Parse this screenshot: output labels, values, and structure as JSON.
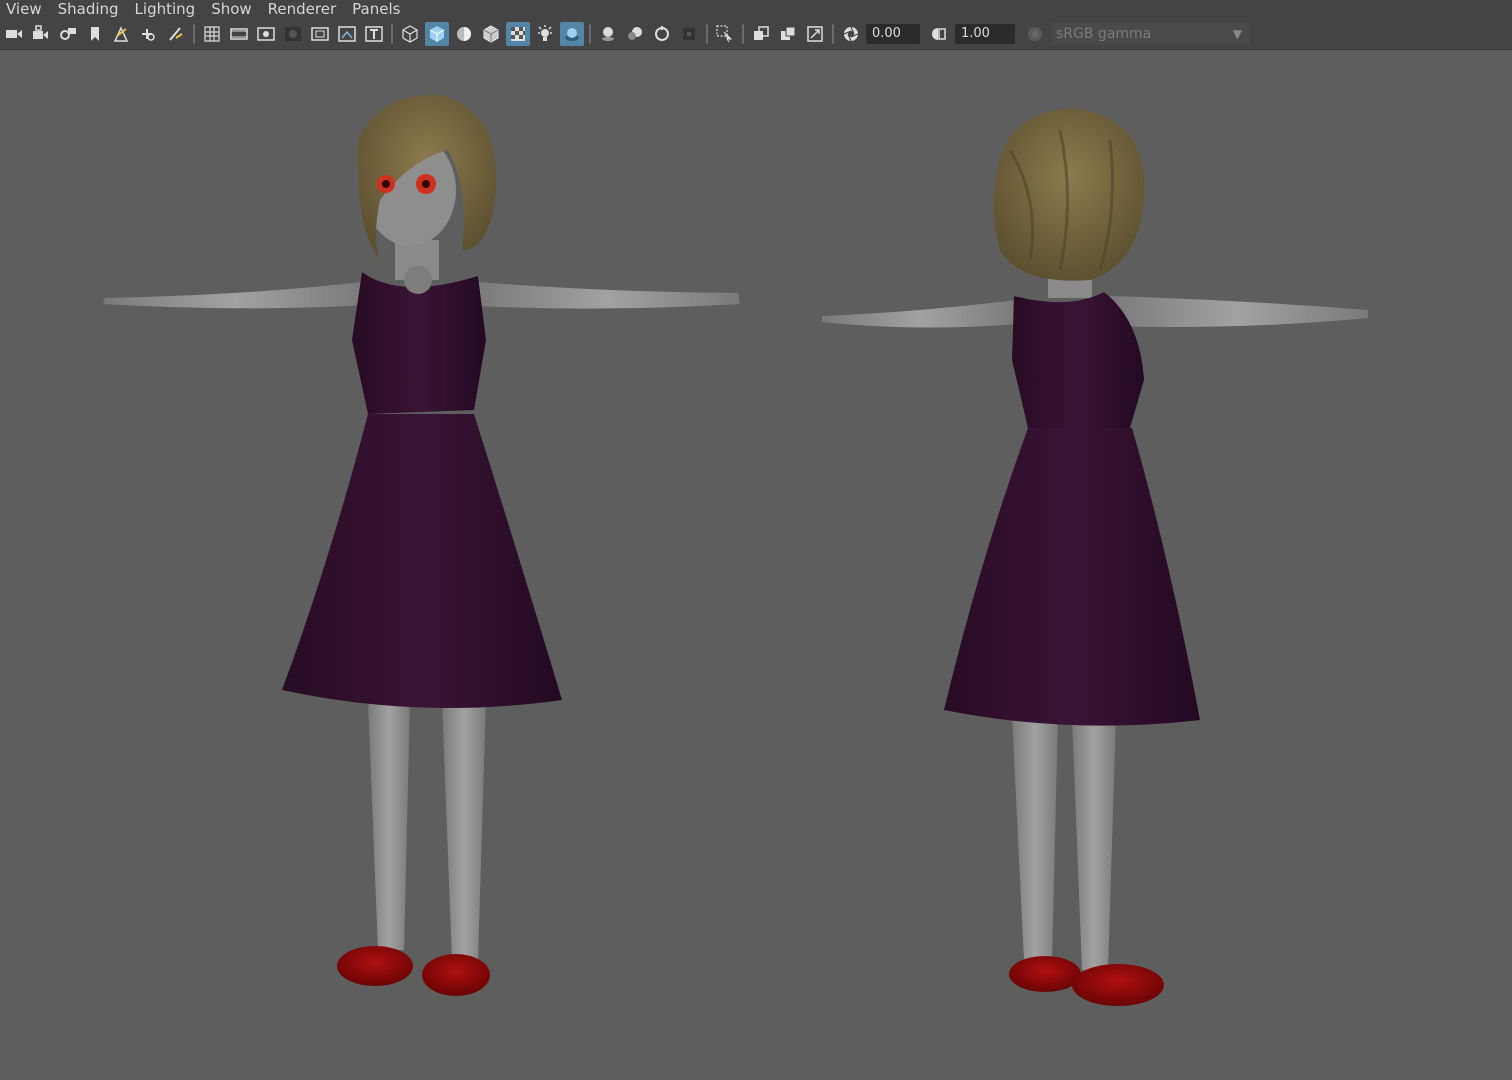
{
  "menubar": {
    "items": [
      {
        "label": "View"
      },
      {
        "label": "Shading"
      },
      {
        "label": "Lighting"
      },
      {
        "label": "Show"
      },
      {
        "label": "Renderer"
      },
      {
        "label": "Panels"
      }
    ]
  },
  "toolbar": {
    "exposure_value": "0.00",
    "gamma_value": "1.00",
    "color_space": "sRGB gamma",
    "icons": [
      "camera-icon",
      "camera-lock-icon",
      "camera-attributes-icon",
      "bookmark-icon",
      "image-plane-icon",
      "grease-pencil-icon",
      "2d-pan-zoom-icon",
      "grid-icon",
      "film-gate-icon",
      "resolution-gate-icon",
      "gate-mask-icon",
      "field-chart-icon",
      "safe-action-icon",
      "safe-title-icon",
      "wireframe-icon",
      "smooth-shade-icon",
      "default-material-icon",
      "wireframe-on-shaded-icon",
      "xray-icon",
      "use-all-lights-icon",
      "shadows-icon",
      "screen-space-ambient-occlusion-icon",
      "motion-blur-icon",
      "multisample-antialiasing-icon",
      "depth-of-field-icon",
      "isolate-select-icon",
      "xray-joints-icon",
      "xray-active-components-icon",
      "backface-culling-icon",
      "exposure-icon",
      "gamma-icon",
      "color-management-icon"
    ]
  },
  "colors": {
    "viewport_bg": "#5e5e5e",
    "toolbar_bg": "#444444",
    "active_button": "#5285a6",
    "dress": "#2f0f2b",
    "skin": "#8f8f8f",
    "hair": "#7a6a40",
    "shoes": "#8a0a0a"
  }
}
